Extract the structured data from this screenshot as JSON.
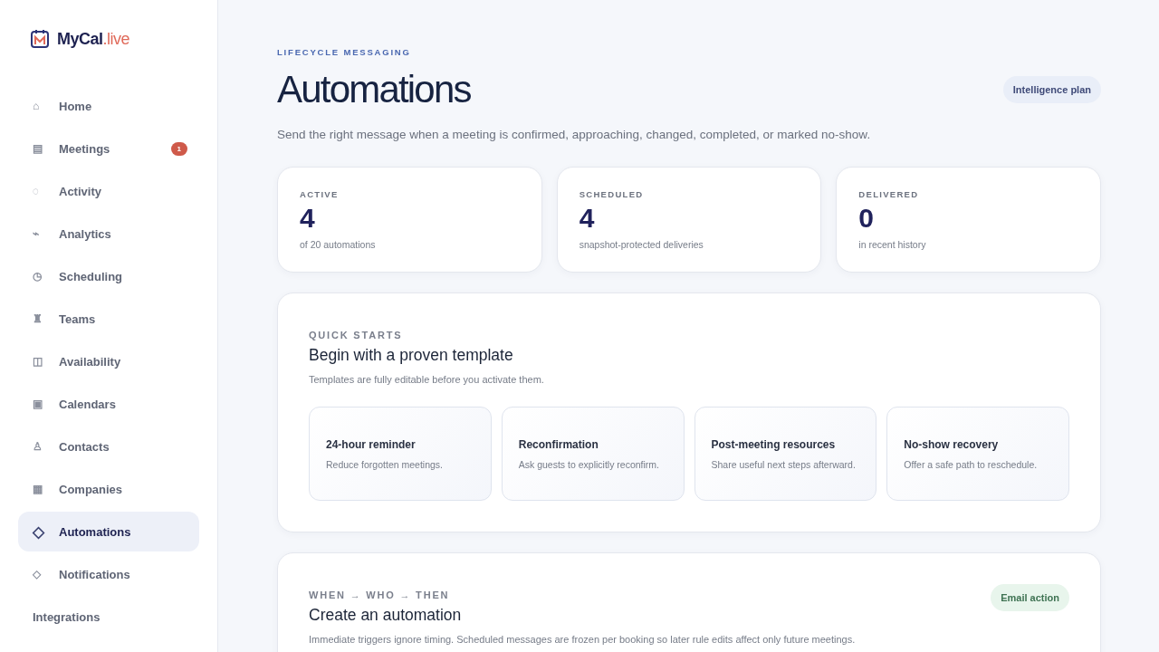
{
  "brand": {
    "name": "MyCal",
    "suffix": ".live"
  },
  "nav": [
    {
      "glyph": "⌂",
      "label": "Home",
      "selected": false
    },
    {
      "glyph": "▤",
      "label": "Meetings",
      "selected": false,
      "badge": "1"
    },
    {
      "glyph": "◌",
      "label": "Activity",
      "selected": false
    },
    {
      "glyph": "⌁",
      "label": "Analytics",
      "selected": false
    },
    {
      "glyph": "◷",
      "label": "Scheduling",
      "selected": false
    },
    {
      "glyph": "♜",
      "label": "Teams",
      "selected": false
    },
    {
      "glyph": "◫",
      "label": "Availability",
      "selected": false
    },
    {
      "glyph": "▣",
      "label": "Calendars",
      "selected": false
    },
    {
      "glyph": "♙",
      "label": "Contacts",
      "selected": false
    },
    {
      "glyph": "▦",
      "label": "Companies",
      "selected": false
    },
    {
      "glyph": "◇",
      "label": "Automations",
      "selected": true
    },
    {
      "glyph": "◇",
      "label": "Notifications",
      "selected": false
    },
    {
      "label": "Integrations",
      "selected": false
    }
  ],
  "header": {
    "eyebrow": "LIFECYCLE MESSAGING",
    "title": "Automations",
    "plan": "Intelligence plan",
    "subtitle": "Send the right message when a meeting is confirmed, approaching, changed, completed, or marked no-show."
  },
  "stats": [
    {
      "label": "ACTIVE",
      "value": "4",
      "note": "of 20 automations"
    },
    {
      "label": "SCHEDULED",
      "value": "4",
      "note": "snapshot-protected deliveries"
    },
    {
      "label": "DELIVERED",
      "value": "0",
      "note": "in recent history"
    }
  ],
  "quick_starts": {
    "eyebrow": "QUICK STARTS",
    "title": "Begin with a proven template",
    "description": "Templates are fully editable before you activate them.",
    "templates": [
      {
        "title": "24-hour reminder",
        "description": "Reduce forgotten meetings."
      },
      {
        "title": "Reconfirmation",
        "description": "Ask guests to explicitly reconfirm."
      },
      {
        "title": "Post-meeting resources",
        "description": "Share useful next steps afterward."
      },
      {
        "title": "No-show recovery",
        "description": "Offer a safe path to reschedule."
      }
    ]
  },
  "create": {
    "eyebrow": "WHEN → WHO → THEN",
    "title": "Create an automation",
    "tag": "Email action",
    "description": "Immediate triggers ignore timing. Scheduled messages are frozen per booking so later rule edits affect only future meetings."
  }
}
